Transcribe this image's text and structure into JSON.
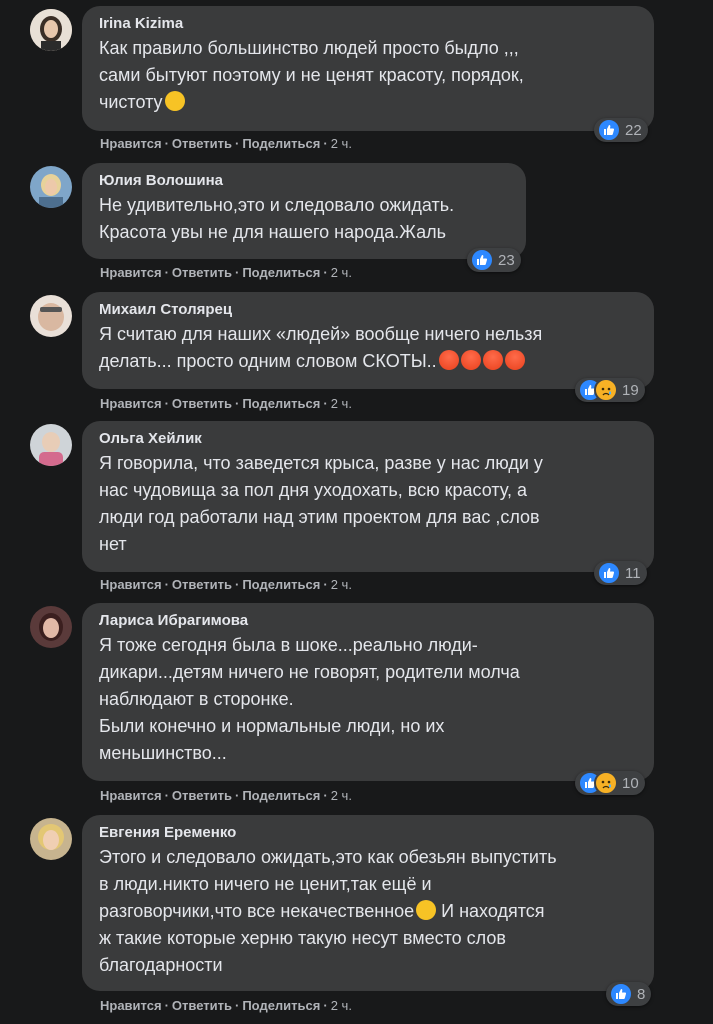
{
  "actions": {
    "like": "Нравится",
    "reply": "Ответить",
    "share": "Поделиться",
    "sep": "·"
  },
  "comments": [
    {
      "author": "Irina Kizima",
      "lines": [
        "Как правило большинство людей просто быдло ,,,",
        "сами бытуют поэтому и не ценят красоту, порядок,",
        "чистоту"
      ],
      "time": "2 ч.",
      "reactions": "22",
      "avatar_color": "#c9b8a6"
    },
    {
      "author": "Юлия Волошина",
      "lines": [
        "Не удивительно,это и следовало ожидать.",
        "Красота увы не для нашего народа.Жаль"
      ],
      "time": "2 ч.",
      "reactions": "23",
      "avatar_color": "#8fa7c0"
    },
    {
      "author": "Михаил Столярец",
      "lines": [
        "Я считаю для наших «людей» вообще ничего нельзя",
        "делать... просто одним словом СКОТЫ.."
      ],
      "time": "2 ч.",
      "reactions": "19",
      "avatar_color": "#d6c7bd"
    },
    {
      "author": "Ольга Хейлик",
      "lines": [
        "Я говорила, что заведется крыса, разве у нас люди у",
        "нас чудовища за пол дня уходохать, всю красоту, а",
        "люди год работали над этим проектом для вас ,слов",
        "нет"
      ],
      "time": "2 ч.",
      "reactions": "11",
      "avatar_color": "#d7a9ae"
    },
    {
      "author": "Лариса Ибрагимова",
      "lines": [
        "Я тоже сегодня была в шоке...реально люди-",
        "дикари...детям ничего не говорят, родители молча",
        "наблюдают в сторонке.",
        "Были конечно и нормальные люди, но их",
        "меньшинство..."
      ],
      "time": "2 ч.",
      "reactions": "10",
      "avatar_color": "#8b5a5a"
    },
    {
      "author": "Евгения Еременко",
      "lines": [
        "Этого и следовало ожидать,это как обезьян выпустить",
        "в люди.никто ничего не ценит,так ещё и",
        "разговорчики,что все некачественное",
        "ж такие которые херню такую несут вместо слов",
        "благодарности"
      ],
      "time": "2 ч.",
      "reactions": "8",
      "avatar_color": "#d9c38f",
      "line3_suffix": " И находятся"
    }
  ]
}
